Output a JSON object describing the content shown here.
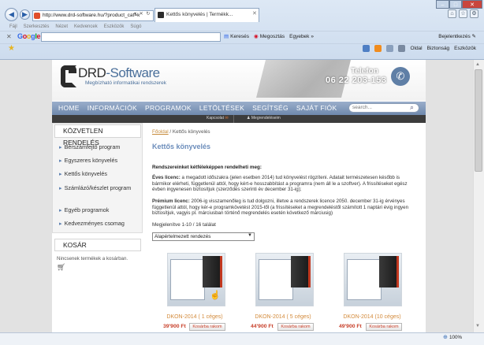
{
  "browser": {
    "address": "http://www.drd-software.hu/?product_cat=k",
    "tab_title": "Kettős könyvelés | Termékk...",
    "menu": [
      "Fájl",
      "Szerkesztés",
      "Nézet",
      "Kedvencek",
      "Eszközök",
      "Súgó"
    ],
    "google": {
      "logo": "Google",
      "search_label": "Keresés",
      "share_label": "Megosztás",
      "more_label": "Egyebek",
      "settings_label": "Bejelentkezés"
    },
    "command_bar": [
      "Oldal",
      "Biztonság",
      "Eszközök"
    ],
    "zoom": "100%"
  },
  "site": {
    "logo_name_a": "DRD",
    "logo_name_b": "-Software",
    "tagline": "Megbízható informatikai rendszerek",
    "phone_label": "Telefon",
    "phone_number": "06 22 203-153",
    "nav": [
      "HOME",
      "INFORMÁCIÓK",
      "PROGRAMOK",
      "LETÖLTÉSEK",
      "SEGÍTSÉG",
      "SAJÁT FIÓK"
    ],
    "search_placeholder": "search...",
    "subbar": {
      "contact": "Kapcsolat",
      "orders": "Megrendeléseim"
    }
  },
  "sidebar": {
    "title": "KÖZVETLEN RENDELÉS",
    "items": [
      "Bérszámfejtő program",
      "Egyszeres könyvelés",
      "Kettős könyvelés",
      "Számlázó/készlet program",
      "Egyéb programok",
      "Kedvezményes csomag"
    ],
    "cart_title": "KOSÁR",
    "cart_empty": "Nincsenek termékek a kosárban."
  },
  "main": {
    "breadcrumb_home": "Főoldal",
    "breadcrumb_current": " / Kettős könyvelés",
    "title": "Kettős könyvelés",
    "intro": "Rendszereinket kétféleképpen rendelheti meg:",
    "p1_bold": "Éves licenc:",
    "p1_text": " a megadott időszakra (jelen esetben 2014) tud könyvelést rögzíteni. Adatait természetesen később is bármikor elérheti, függetlenül attól, hogy kért-e hosszabbítást a programra (nem áll le a szoftver). A frissítéseket egész évben ingyenesen biztosítjuk (szerződés szerinti év december 31-ig);",
    "p2_bold": "Prémium licenc:",
    "p2_text": " 2006-ig visszamenőleg is tud dolgozni, illetve a rendszerek licence 2050. december 31-ig érvényes függetlenül attól, hogy kér-e programkövetést 2015-től (a frissítéseket a megrendeléstől számított 1 naptári évig ingyen biztosítjuk, vagyis pl. márciusban történő megrendelés esetén következő márciusig)",
    "count": "Megjelenítve 1-10 / 16 találat",
    "sort": "Alapértelmezett rendezés",
    "products": [
      {
        "name": "DKON-2014 ( 1 céges)",
        "price": "39'900 Ft",
        "button": "Kosárba rakom"
      },
      {
        "name": "DKON-2014 ( 5 céges)",
        "price": "44'900 Ft",
        "button": "Kosárba rakom"
      },
      {
        "name": "DKON-2014 (10 céges)",
        "price": "49'900 Ft",
        "button": "Kosárba rakom"
      }
    ]
  }
}
